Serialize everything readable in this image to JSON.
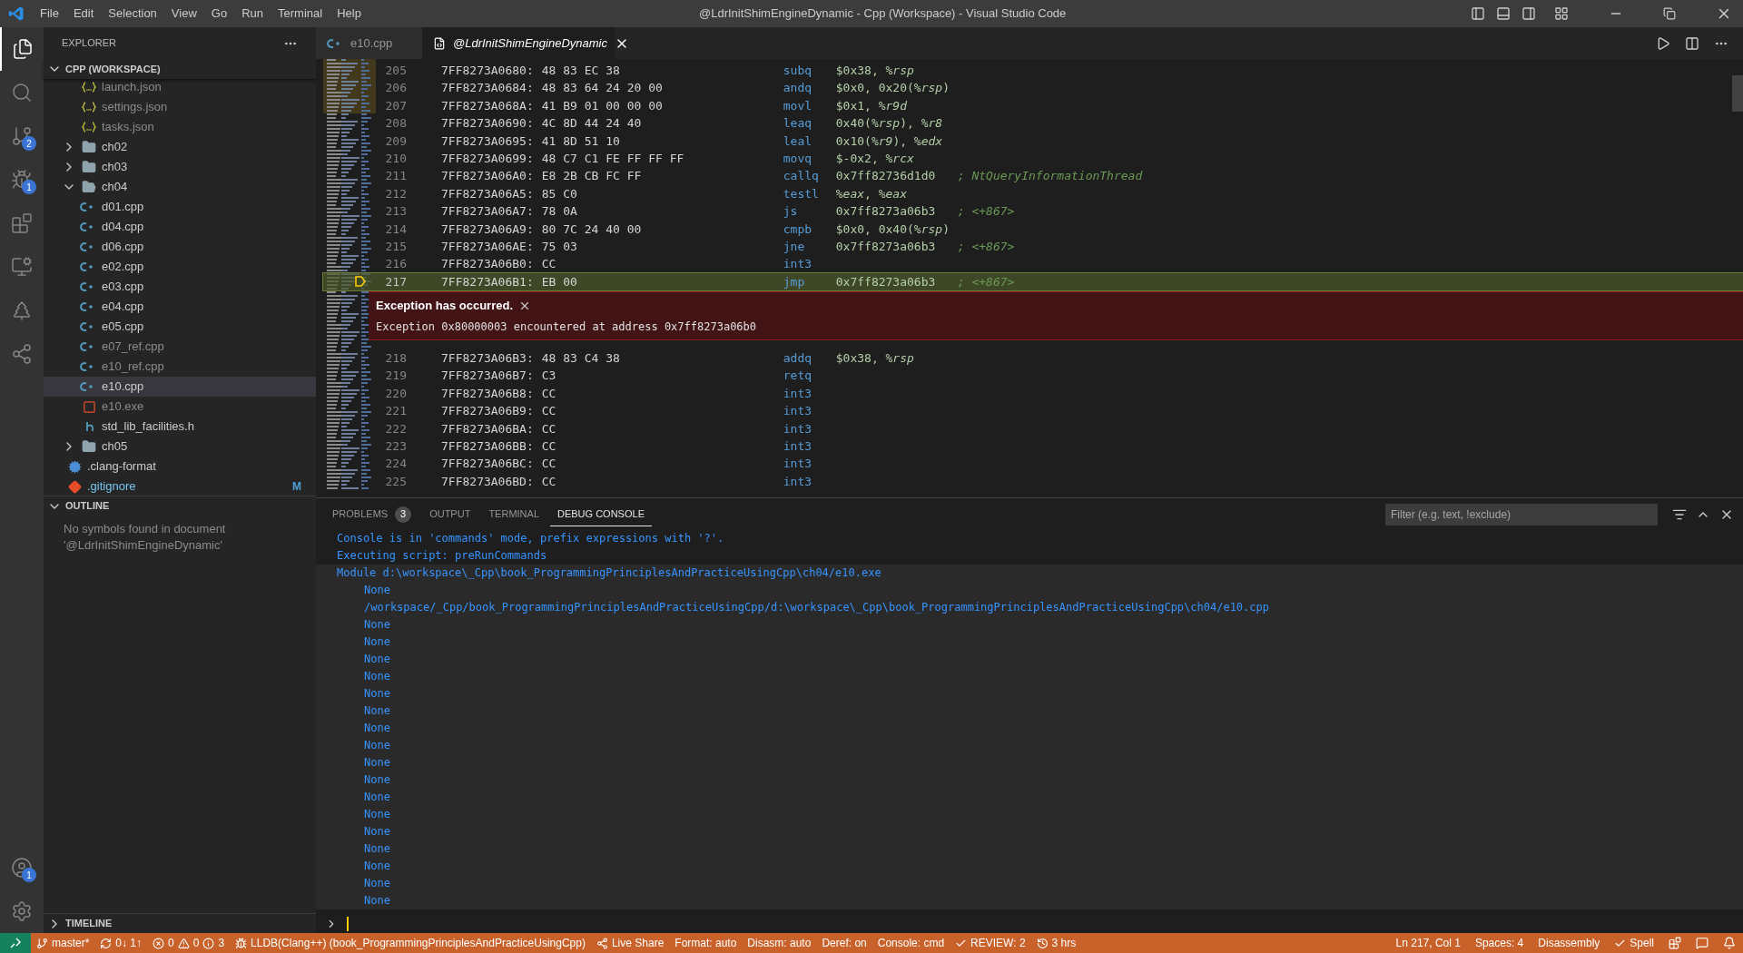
{
  "title_bar": {
    "menu": [
      "File",
      "Edit",
      "Selection",
      "View",
      "Go",
      "Run",
      "Terminal",
      "Help"
    ],
    "title": "@LdrInitShimEngineDynamic - Cpp (Workspace) - Visual Studio Code"
  },
  "activity_bar": {
    "items": [
      {
        "kind": "files",
        "selected": true
      },
      {
        "kind": "search",
        "selected": false
      },
      {
        "kind": "source-control",
        "selected": false,
        "badge": "2"
      },
      {
        "kind": "debug",
        "selected": false,
        "badge": "1"
      },
      {
        "kind": "extensions",
        "selected": false
      },
      {
        "kind": "remote",
        "selected": false
      },
      {
        "kind": "testing",
        "selected": false
      },
      {
        "kind": "share",
        "selected": false
      }
    ],
    "bottom": [
      {
        "kind": "account",
        "badge": "1"
      },
      {
        "kind": "settings"
      }
    ]
  },
  "sidebar": {
    "title": "EXPLORER",
    "workspace": {
      "label": "CPP (WORKSPACE)",
      "expanded": true
    },
    "tree": [
      {
        "children": [
          {
            "label": "launch.json",
            "kind": "json",
            "ignored": true,
            "selected": false
          },
          {
            "label": "settings.json",
            "kind": "json",
            "ignored": true,
            "selected": false
          },
          {
            "label": "tasks.json",
            "kind": "json",
            "ignored": true,
            "selected": false
          }
        ]
      },
      {
        "label": "ch02",
        "kind": "folder",
        "expanded": false,
        "selected": false
      },
      {
        "label": "ch03",
        "kind": "folder",
        "expanded": false,
        "selected": false
      },
      {
        "label": "ch04",
        "kind": "folder",
        "expanded": true,
        "selected": false,
        "children": [
          {
            "label": "d01.cpp",
            "kind": "cpp",
            "ignored": false,
            "selected": false
          },
          {
            "label": "d04.cpp",
            "kind": "cpp",
            "ignored": false,
            "selected": false
          },
          {
            "label": "d06.cpp",
            "kind": "cpp",
            "ignored": false,
            "selected": false
          },
          {
            "label": "e02.cpp",
            "kind": "cpp",
            "ignored": false,
            "selected": false
          },
          {
            "label": "e03.cpp",
            "kind": "cpp",
            "ignored": false,
            "selected": false
          },
          {
            "label": "e04.cpp",
            "kind": "cpp",
            "ignored": false,
            "selected": false
          },
          {
            "label": "e05.cpp",
            "kind": "cpp",
            "ignored": false,
            "selected": false
          },
          {
            "label": "e07_ref.cpp",
            "kind": "cpp",
            "ignored": true,
            "selected": false
          },
          {
            "label": "e10_ref.cpp",
            "kind": "cpp",
            "ignored": true,
            "selected": false
          },
          {
            "label": "e10.cpp",
            "kind": "cpp",
            "ignored": false,
            "selected": true
          },
          {
            "label": "e10.exe",
            "kind": "exe",
            "ignored": true,
            "selected": false
          },
          {
            "label": "std_lib_facilities.h",
            "kind": "header",
            "ignored": false,
            "selected": false
          }
        ]
      },
      {
        "label": "ch05",
        "kind": "folder",
        "expanded": false,
        "selected": false
      },
      {
        "label": ".clang-format",
        "kind": "config",
        "ignored": false,
        "selected": false
      },
      {
        "label": ".gitignore",
        "kind": "git",
        "ignored": false,
        "modified": true,
        "badge": "M",
        "selected": false
      }
    ],
    "outline": {
      "label": "OUTLINE",
      "expanded": true,
      "message": "No symbols found in document '@LdrInitShimEngineDynamic'"
    },
    "timeline": {
      "label": "TIMELINE",
      "expanded": false
    }
  },
  "tabs": [
    {
      "label": "e10.cpp",
      "selected": false,
      "preview": false
    },
    {
      "label": "@LdrInitShimEngineDynamic",
      "selected": true,
      "preview": true
    }
  ],
  "code": [
    {
      "line": "205",
      "address": "7FF8273A0680:",
      "bytes": "48 83 EC 38",
      "op": "subq",
      "args": "$0x38, *%rsp*",
      "current": false
    },
    {
      "line": "206",
      "address": "7FF8273A0684:",
      "bytes": "48 83 64 24 20 00",
      "op": "andq",
      "args": "$0x0, 0x20(*%rsp*)",
      "current": false
    },
    {
      "line": "207",
      "address": "7FF8273A068A:",
      "bytes": "41 B9 01 00 00 00",
      "op": "movl",
      "args": "$0x1, *%r9d*",
      "current": false
    },
    {
      "line": "208",
      "address": "7FF8273A0690:",
      "bytes": "4C 8D 44 24 40",
      "op": "leaq",
      "args": "0x40(*%rsp*), *%r8*",
      "current": false
    },
    {
      "line": "209",
      "address": "7FF8273A0695:",
      "bytes": "41 8D 51 10",
      "op": "leal",
      "args": "0x10(*%r9*), *%edx*",
      "current": false
    },
    {
      "line": "210",
      "address": "7FF8273A0699:",
      "bytes": "48 C7 C1 FE FF FF FF",
      "op": "movq",
      "args": "$-0x2, *%rcx*",
      "current": false
    },
    {
      "line": "211",
      "address": "7FF8273A06A0:",
      "bytes": "E8 2B CB FC FF",
      "op": "callq",
      "args": "0x7ff82736d1d0",
      "comment": "; NtQueryInformationThread",
      "current": false
    },
    {
      "line": "212",
      "address": "7FF8273A06A5:",
      "bytes": "85 C0",
      "op": "testl",
      "args": "*%eax*, *%eax*",
      "current": false
    },
    {
      "line": "213",
      "address": "7FF8273A06A7:",
      "bytes": "78 0A",
      "op": "js",
      "args": "0x7ff8273a06b3",
      "comment": "; <+867>",
      "current": false
    },
    {
      "line": "214",
      "address": "7FF8273A06A9:",
      "bytes": "80 7C 24 40 00",
      "op": "cmpb",
      "args": "$0x0, 0x40(*%rsp*)",
      "current": false
    },
    {
      "line": "215",
      "address": "7FF8273A06AE:",
      "bytes": "75 03",
      "op": "jne",
      "args": "0x7ff8273a06b3",
      "comment": "; <+867>",
      "current": false
    },
    {
      "line": "216",
      "address": "7FF8273A06B0:",
      "bytes": "CC",
      "op": "int3",
      "current": false
    },
    {
      "line": "217",
      "address": "7FF8273A06B1:",
      "bytes": "EB 00",
      "op": "jmp",
      "args": "0x7ff8273a06b3",
      "comment": "; <+867>",
      "current": true
    },
    {
      "line": "218",
      "address": "7FF8273A06B3:",
      "bytes": "48 83 C4 38",
      "op": "addq",
      "args": "$0x38, *%rsp*",
      "current": false
    },
    {
      "line": "219",
      "address": "7FF8273A06B7:",
      "bytes": "C3",
      "op": "retq",
      "current": false
    },
    {
      "line": "220",
      "address": "7FF8273A06B8:",
      "bytes": "CC",
      "op": "int3",
      "current": false
    },
    {
      "line": "221",
      "address": "7FF8273A06B9:",
      "bytes": "CC",
      "op": "int3",
      "current": false
    },
    {
      "line": "222",
      "address": "7FF8273A06BA:",
      "bytes": "CC",
      "op": "int3",
      "current": false
    },
    {
      "line": "223",
      "address": "7FF8273A06BB:",
      "bytes": "CC",
      "op": "int3",
      "current": false
    },
    {
      "line": "224",
      "address": "7FF8273A06BC:",
      "bytes": "CC",
      "op": "int3",
      "current": false
    },
    {
      "line": "225",
      "address": "7FF8273A06BD:",
      "bytes": "CC",
      "op": "int3",
      "current": false
    }
  ],
  "exception": {
    "title": "Exception has occurred.",
    "message": "Exception 0x80000003 encountered at address 0x7ff8273a06b0"
  },
  "panel": {
    "tabs": [
      {
        "label": "PROBLEMS",
        "badge": "3",
        "selected": false
      },
      {
        "label": "OUTPUT",
        "selected": false
      },
      {
        "label": "TERMINAL",
        "selected": false
      },
      {
        "label": "DEBUG CONSOLE",
        "selected": true
      }
    ],
    "filter": {
      "placeholder": "Filter (e.g. text, !exclude)"
    },
    "console": [
      {
        "kind": "message",
        "text": "Console is in 'commands' mode, prefix expressions with '?'."
      },
      {
        "kind": "message",
        "text": "Executing script: preRunCommands"
      },
      {
        "kind": "group",
        "text": "Module d:\\workspace\\_Cpp\\book_ProgrammingPrinciplesAndPracticeUsingCpp\\ch04/e10.exe"
      },
      {
        "kind": "item",
        "text": "None"
      },
      {
        "kind": "item",
        "text": "/workspace/_Cpp/book_ProgrammingPrinciplesAndPracticeUsingCpp/d:\\workspace\\_Cpp\\book_ProgrammingPrinciplesAndPracticeUsingCpp\\ch04/e10.cpp"
      },
      {
        "kind": "item",
        "text": "None"
      },
      {
        "kind": "item",
        "text": "None"
      },
      {
        "kind": "item",
        "text": "None"
      },
      {
        "kind": "item",
        "text": "None"
      },
      {
        "kind": "item",
        "text": "None"
      },
      {
        "kind": "item",
        "text": "None"
      },
      {
        "kind": "item",
        "text": "None"
      },
      {
        "kind": "item",
        "text": "None"
      },
      {
        "kind": "item",
        "text": "None"
      },
      {
        "kind": "item",
        "text": "None"
      },
      {
        "kind": "item",
        "text": "None"
      },
      {
        "kind": "item",
        "text": "None"
      },
      {
        "kind": "item",
        "text": "None"
      },
      {
        "kind": "item",
        "text": "None"
      },
      {
        "kind": "item",
        "text": "None"
      },
      {
        "kind": "item",
        "text": "None"
      },
      {
        "kind": "item",
        "text": "None"
      }
    ]
  },
  "status_bar": {
    "left": [
      {
        "kind": "branch",
        "text": "master*"
      },
      {
        "kind": "sync",
        "text": "0↓ 1↑"
      },
      {
        "kind": "problems",
        "errors": "0",
        "warnings": "0",
        "infos": "3"
      },
      {
        "kind": "debug",
        "text": "LLDB(Clang++) (book_ProgrammingPrinciplesAndPracticeUsingCpp)"
      },
      {
        "kind": "share",
        "text": "Live Share"
      },
      {
        "kind": "plain",
        "text": "Format: auto"
      },
      {
        "kind": "plain",
        "text": "Disasm: auto"
      },
      {
        "kind": "plain",
        "text": "Deref: on"
      },
      {
        "kind": "plain",
        "text": "Console: cmd"
      },
      {
        "kind": "check",
        "text": "REVIEW: 2"
      },
      {
        "kind": "history",
        "text": "3 hrs"
      }
    ],
    "right": [
      {
        "kind": "plain",
        "text": "Ln 217, Col 1"
      },
      {
        "kind": "plain",
        "text": "Spaces: 4"
      },
      {
        "kind": "plain",
        "text": "Disassembly"
      },
      {
        "kind": "check",
        "text": "Spell"
      }
    ]
  }
}
